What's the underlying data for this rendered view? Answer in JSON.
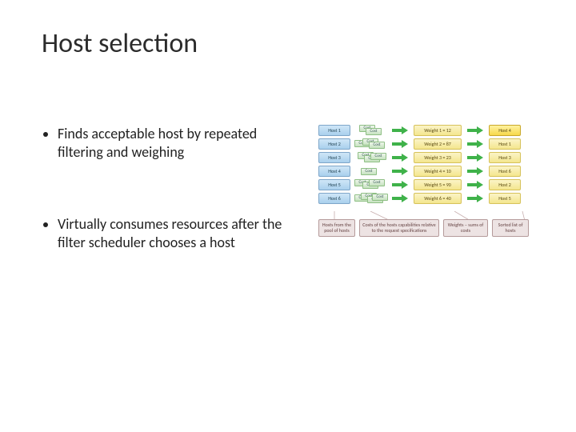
{
  "title": "Host selection",
  "bullets": [
    "Finds acceptable host by repeated filtering and weighing",
    "Virtually consumes resources after the filter scheduler chooses a host"
  ],
  "diagram": {
    "hosts": [
      "Host 1",
      "Host 2",
      "Host 3",
      "Host 4",
      "Host 5",
      "Host 6"
    ],
    "cost_label": "Cost",
    "weights": [
      "Weight 1 = 12",
      "Weight 2 = 87",
      "Weight 3 = 23",
      "Weight 4 = 10",
      "Weight 5 = 90",
      "Weight 6 = 40"
    ],
    "sorted": [
      "Host 4",
      "Host 1",
      "Host 3",
      "Host 6",
      "Host 2",
      "Host 5"
    ],
    "captions": {
      "hosts": "Hosts from the pool of hosts",
      "costs": "Costs of the hosts capabilities relative to the request specifications",
      "weights": "Weights – sums of costs",
      "sorted": "Sorted list of hosts"
    }
  }
}
